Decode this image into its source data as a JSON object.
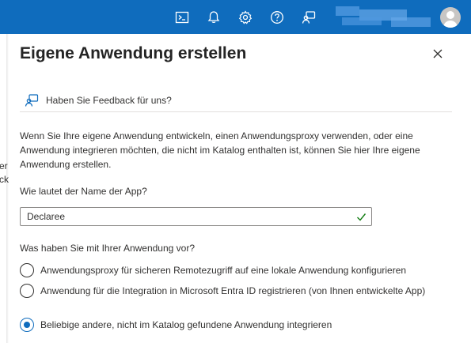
{
  "topbar": {
    "icons": [
      "cloud-shell-icon",
      "bell-icon",
      "settings-gear-icon",
      "help-icon",
      "feedback-icon"
    ],
    "accent": "#0f6cbd"
  },
  "panel": {
    "title": "Eigene Anwendung erstellen",
    "feedback_label": "Haben Sie Feedback für uns?",
    "description": "Wenn Sie Ihre eigene Anwendung entwickeln, einen Anwendungsproxy verwenden, oder eine Anwendung integrieren möchten, die nicht im Katalog enthalten ist, können Sie hier Ihre eigene Anwendung erstellen.",
    "name_label": "Wie lautet der Name der App?",
    "name_value": "Declaree",
    "name_valid": true,
    "purpose_label": "Was haben Sie mit Ihrer Anwendung vor?",
    "options": [
      {
        "label": "Anwendungsproxy für sicheren Remotezugriff auf eine lokale Anwendung konfigurieren",
        "selected": false
      },
      {
        "label": "Anwendung für die Integration in Microsoft Entra ID registrieren (von Ihnen entwickelte App)",
        "selected": false
      },
      {
        "label": "Beliebige andere, nicht im Katalog gefundene Anwendung integrieren",
        "selected": true
      }
    ]
  },
  "background": {
    "fragments": [
      "er",
      "ck"
    ]
  },
  "colors": {
    "brand": "#0f6cbd",
    "success": "#107c10",
    "text": "#323130"
  }
}
